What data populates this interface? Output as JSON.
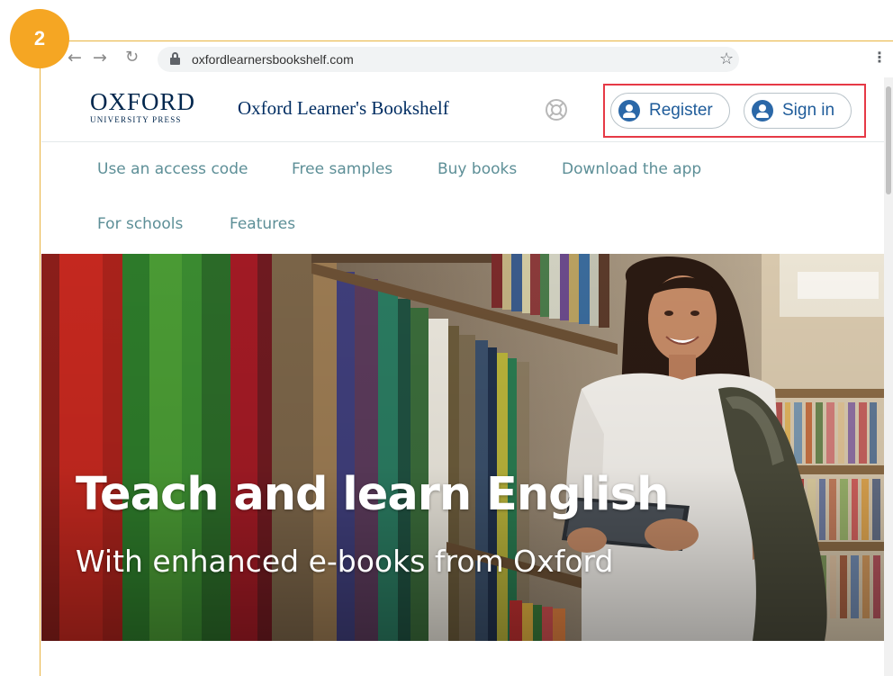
{
  "step": {
    "number": "2",
    "color": "#f5a623"
  },
  "browser": {
    "url": "oxfordlearnersbookshelf.com",
    "icons": [
      "back-arrow-icon",
      "forward-arrow-icon",
      "reload-icon",
      "lock-icon",
      "star-icon",
      "kebab-menu-icon"
    ]
  },
  "header": {
    "logo": {
      "main": "OXFORD",
      "sub": "UNIVERSITY PRESS"
    },
    "site_title": "Oxford Learner's Bookshelf",
    "register_label": "Register",
    "signin_label": "Sign in",
    "highlight_color": "#e63946"
  },
  "nav": {
    "items": [
      "Use an access code",
      "Free samples",
      "Buy books",
      "Download the app",
      "For schools",
      "Features"
    ],
    "link_color": "#5d8f97"
  },
  "hero": {
    "title": "Teach and learn English",
    "subtitle": "With enhanced e-books from Oxford"
  }
}
